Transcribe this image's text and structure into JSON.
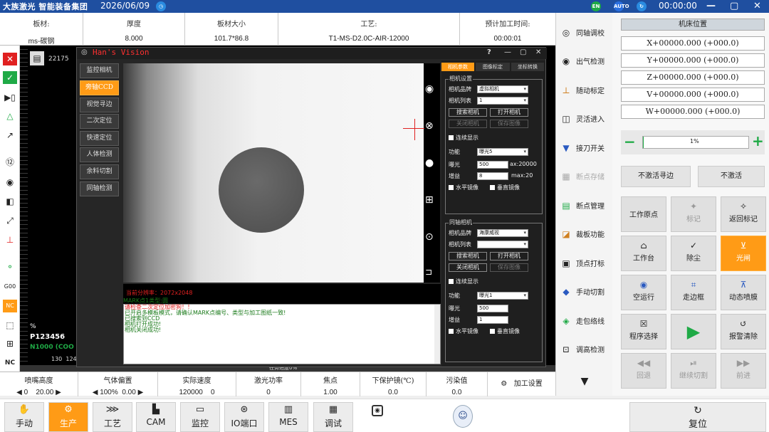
{
  "topbar": {
    "logo": "大族激光 智能装备集团",
    "date": "2026/06/09",
    "badge_en": "EN",
    "badge_auto": "AUTO",
    "time": "00:00:00"
  },
  "info": {
    "headers": [
      "板材:",
      "厚度",
      "板材大小",
      "工艺:",
      "预计加工时间:"
    ],
    "values": [
      "ms-碳钢",
      "8.000",
      "101.7*86.8",
      "T1-MS-D2.0C-AIR-12000",
      "00:00:01"
    ]
  },
  "canvas": {
    "coord": "22175",
    "pct": "%",
    "part": "P123456",
    "speed": "N1000 (COO",
    "progress_label": "任务进度0%"
  },
  "dialog": {
    "title": "Han's Vision",
    "nav": [
      "监控相机",
      "旁轴CCD",
      "视觉寻边",
      "二次定位",
      "快速定位",
      "人体检测",
      "余料切割",
      "同轴检测"
    ],
    "tabs": [
      "相机参数",
      "图像标定",
      "坐标转换"
    ],
    "cam1": {
      "group": "相机设置",
      "brand_label": "相机品牌",
      "brand": "虚拟相机",
      "list_label": "相机列表",
      "list": "1",
      "search": "搜索相机",
      "open": "打开相机",
      "close": "关闭相机",
      "save": "保存图像",
      "continuous": "连续显示",
      "func_label": "功能",
      "func": "曝光5",
      "exposure_label": "曝光",
      "exposure": "500",
      "exposure_max": "ax:20000",
      "gain_label": "增益",
      "gain": "8",
      "gain_max": "max:20",
      "hmirror": "水平镜像",
      "vmirror": "垂直镜像"
    },
    "cam2": {
      "group": "同轴相机",
      "brand_label": "相机品牌",
      "brand": "海康威视",
      "list_label": "相机列表",
      "list": "",
      "search": "搜索相机",
      "open": "打开相机",
      "close": "关闭相机",
      "save": "保存图像",
      "continuous": "连续显示",
      "func_label": "功能",
      "func": "曝光1",
      "exposure_label": "曝光",
      "exposure": "500",
      "gain_label": "增益",
      "gain": "1",
      "hmirror": "水平镜像",
      "vmirror": "垂直镜像"
    },
    "status": "当前分辨率：2072x2048",
    "log": [
      {
        "text": "MARK点1类型:圆",
        "color": "#1a7a1a"
      },
      {
        "text": "请检查二次定位加密狗！！",
        "color": "#e01818"
      },
      {
        "text": "已开启多模板模式，请确认MARK点编号、类型与加工图纸一致!",
        "color": "#1a7a1a"
      },
      {
        "text": "已搜索到CCD",
        "color": "#1a7a1a"
      },
      {
        "text": "相机打开成功!",
        "color": "#1a7a1a"
      },
      {
        "text": "相机关闭成功!",
        "color": "#1a7a1a"
      }
    ]
  },
  "right_panel": {
    "items": [
      {
        "icon": "◎",
        "label": "同轴调校",
        "enabled": true
      },
      {
        "icon": "◉",
        "label": "出气检测",
        "enabled": true
      },
      {
        "icon": "⊥",
        "label": "随动标定",
        "enabled": true
      },
      {
        "icon": "◫",
        "label": "灵活进入",
        "enabled": true
      },
      {
        "icon": "▼",
        "label": "接刀开关",
        "enabled": true
      },
      {
        "icon": "▦",
        "label": "断点存储",
        "enabled": false
      },
      {
        "icon": "▤",
        "label": "断点管理",
        "enabled": true
      },
      {
        "icon": "◪",
        "label": "裁板功能",
        "enabled": true
      },
      {
        "icon": "▣",
        "label": "顶点打标",
        "enabled": true
      },
      {
        "icon": "◆",
        "label": "手动切割",
        "enabled": true
      },
      {
        "icon": "◈",
        "label": "走包络线",
        "enabled": true
      },
      {
        "icon": "⊡",
        "label": "调高检测",
        "enabled": true
      }
    ]
  },
  "axes": {
    "header": "机床位置",
    "values": [
      "X+00000.000 (+000.0)",
      "Y+00000.000 (+000.0)",
      "Z+00000.000 (+000.0)",
      "V+00000.000 (+000.0)",
      "W+00000.000 (+000.0)"
    ],
    "slider_pct": "1%",
    "slider_value": 0.01
  },
  "machine": {
    "top_buttons": [
      "不激活寻边",
      "不激活"
    ],
    "grid": [
      {
        "icon": "",
        "label": "工作原点",
        "state": "normal"
      },
      {
        "icon": "✦",
        "label": "标记",
        "state": "off"
      },
      {
        "icon": "✧",
        "label": "返回标记",
        "state": "normal"
      },
      {
        "icon": "⌂",
        "label": "工作台",
        "state": "normal"
      },
      {
        "icon": "✓",
        "label": "除尘",
        "state": "normal"
      },
      {
        "icon": "⊻",
        "label": "光闸",
        "state": "orange"
      },
      {
        "icon": "◉",
        "label": "空运行",
        "state": "normal"
      },
      {
        "icon": "⌗",
        "label": "走边框",
        "state": "normal"
      },
      {
        "icon": "⊼",
        "label": "动态喷膜",
        "state": "normal"
      },
      {
        "icon": "☒",
        "label": "程序选择",
        "state": "normal"
      },
      {
        "icon": "▶",
        "label": "",
        "state": "play"
      },
      {
        "icon": "↺",
        "label": "报警清除",
        "state": "normal"
      },
      {
        "icon": "◀◀",
        "label": "回退",
        "state": "off"
      },
      {
        "icon": "⏯",
        "label": "继续切割",
        "state": "off"
      },
      {
        "icon": "▶▶",
        "label": "前进",
        "state": "off"
      }
    ]
  },
  "bottom": {
    "headers": [
      "喷嘴高度",
      "气体偏置",
      "实际速度",
      "激光功率",
      "焦点",
      "下保护镜(℃)",
      "污染值"
    ],
    "values": [
      "0",
      "20.00",
      "100%",
      "0.00",
      "120000",
      "0",
      "0",
      "1.00",
      "0.0",
      "0.0"
    ],
    "settings": "加工设置"
  },
  "nav": [
    {
      "icon": "✋",
      "label": "手动",
      "active": false
    },
    {
      "icon": "⚙",
      "label": "生产",
      "active": true
    },
    {
      "icon": "⋙",
      "label": "工艺",
      "active": false
    },
    {
      "icon": "▙",
      "label": "CAM",
      "active": false
    },
    {
      "icon": "▭",
      "label": "监控",
      "active": false
    },
    {
      "icon": "⊛",
      "label": "IO端口",
      "active": false
    },
    {
      "icon": "▥",
      "label": "MES",
      "active": false
    },
    {
      "icon": "▦",
      "label": "调试",
      "active": false
    }
  ],
  "reset_label": "复位"
}
